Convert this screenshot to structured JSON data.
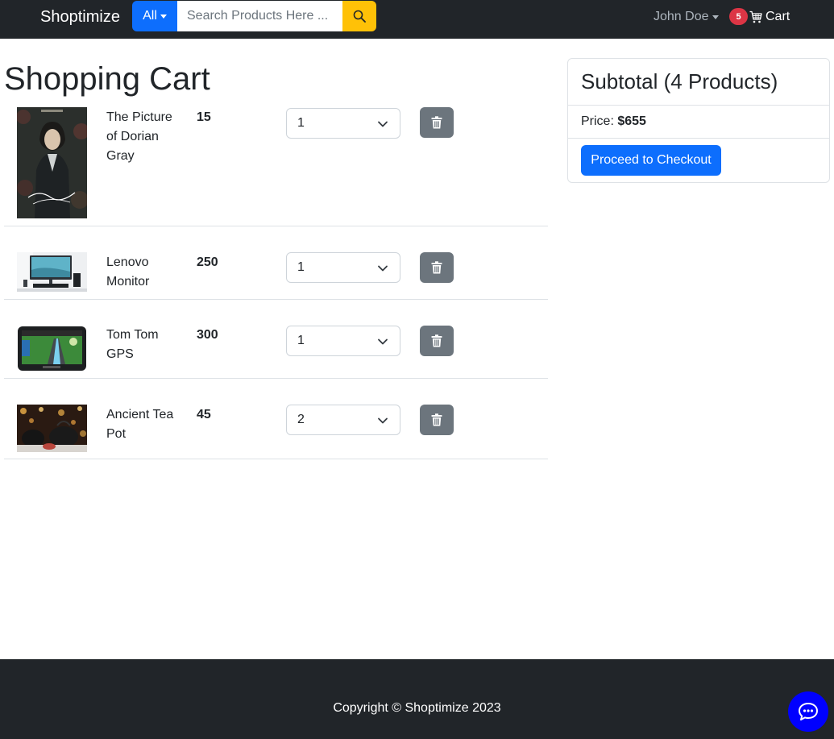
{
  "navbar": {
    "brand": "Shoptimize",
    "category_label": "All",
    "search_placeholder": "Search Products Here ...",
    "user_name": "John Doe",
    "cart_count": "5",
    "cart_label": "Cart"
  },
  "page": {
    "title": "Shopping Cart"
  },
  "cart": {
    "items": [
      {
        "name": "The Picture of Dorian Gray",
        "price": "15",
        "quantity": "1"
      },
      {
        "name": "Lenovo Monitor",
        "price": "250",
        "quantity": "1"
      },
      {
        "name": "Tom Tom GPS",
        "price": "300",
        "quantity": "1"
      },
      {
        "name": "Ancient Tea Pot",
        "price": "45",
        "quantity": "2"
      }
    ]
  },
  "summary": {
    "heading": "Subtotal (4 Products)",
    "price_label": "Price:",
    "price_value": "$655",
    "checkout_label": "Proceed to Checkout"
  },
  "footer": {
    "copyright": "Copyright © Shoptimize 2023"
  },
  "colors": {
    "navbar_bg": "#212529",
    "primary": "#0d6efd",
    "warning": "#ffc107",
    "danger": "#dc3545",
    "secondary": "#6c757d",
    "chat": "#0000ff"
  },
  "icons": {
    "search": "search-icon",
    "cart": "cart-icon",
    "trash": "trash-icon",
    "chat": "chat-icon",
    "select_chevron": "chevron-down-icon",
    "dropdown_caret": "caret-down-icon"
  }
}
